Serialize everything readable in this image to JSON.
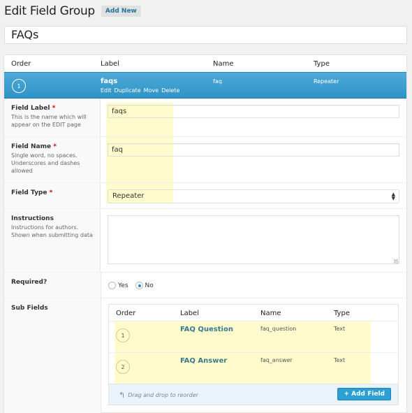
{
  "header": {
    "title": "Edit Field Group",
    "add_new_label": "Add New"
  },
  "group_title": "FAQs",
  "fields_table": {
    "columns": [
      "Order",
      "Label",
      "Name",
      "Type"
    ],
    "active_field": {
      "order": "1",
      "label": "faqs",
      "name": "faq",
      "type": "Repeater",
      "actions": [
        "Edit",
        "Duplicate",
        "Move",
        "Delete"
      ]
    }
  },
  "form": {
    "field_label": {
      "label": "Field Label",
      "required_mark": "*",
      "description": "This is the name which will appear on the EDIT page",
      "value": "faqs"
    },
    "field_name": {
      "label": "Field Name",
      "required_mark": "*",
      "description": "Single word, no spaces. Underscores and dashes allowed",
      "value": "faq"
    },
    "field_type": {
      "label": "Field Type",
      "required_mark": "*",
      "selected": "Repeater"
    },
    "instructions": {
      "label": "Instructions",
      "description": "Instructions for authors. Shown when submitting data",
      "value": ""
    },
    "required": {
      "label": "Required?",
      "options": [
        "Yes",
        "No"
      ],
      "selected": "No"
    },
    "sub_fields": {
      "label": "Sub Fields",
      "columns": [
        "Order",
        "Label",
        "Name",
        "Type"
      ],
      "rows": [
        {
          "order": "1",
          "label": "FAQ Question",
          "name": "faq_question",
          "type": "Text"
        },
        {
          "order": "2",
          "label": "FAQ Answer",
          "name": "faq_answer",
          "type": "Text"
        }
      ],
      "drag_hint": "Drag and drop to reorder",
      "add_field_label": "+ Add Field"
    }
  }
}
